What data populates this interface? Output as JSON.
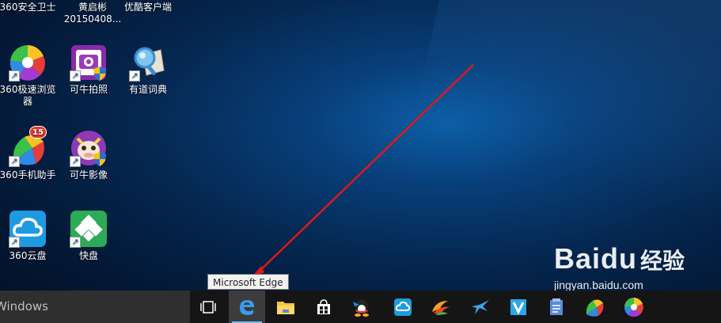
{
  "desktop": {
    "top_row_labels": [
      "360安全卫士",
      "黄启彬",
      "20150408...",
      "优酷客户端"
    ],
    "icons": [
      {
        "name": "360极速浏览器",
        "line1": "360极速浏览",
        "line2": "器"
      },
      {
        "name": "可牛拍照",
        "line1": "可牛拍照"
      },
      {
        "name": "有道词典",
        "line1": "有道词典"
      },
      {
        "name": "360手机助手",
        "line1": "360手机助手",
        "badge": "15"
      },
      {
        "name": "可牛影像",
        "line1": "可牛影像"
      },
      {
        "name": "360云盘",
        "line1": "360云盘"
      },
      {
        "name": "快盘",
        "line1": "快盘"
      }
    ]
  },
  "tooltip": {
    "text": "Microsoft Edge"
  },
  "taskbar": {
    "search_text": "Windows",
    "buttons": [
      "task-view",
      "microsoft-edge",
      "file-explorer",
      "windows-store",
      "qq",
      "360-cloud",
      "browser-swirl",
      "bird-app",
      "v-app",
      "notes-app",
      "360-browser",
      "colorful-app"
    ]
  },
  "watermark": {
    "logo": "Bai",
    "logo_du": "du",
    "cn": "经验",
    "url": "jingyan.baidu.com"
  },
  "colors": {
    "taskbar": "#151515",
    "accent": "#76b9ed",
    "arrow": "#e01818"
  }
}
